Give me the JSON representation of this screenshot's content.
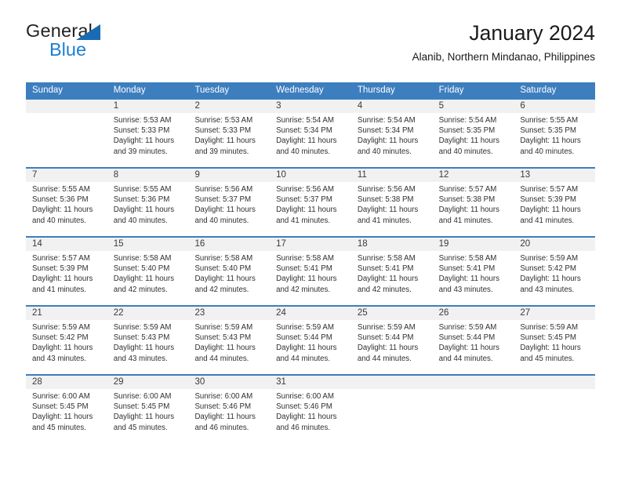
{
  "brand": {
    "name_top": "General",
    "name_bottom": "Blue",
    "colors": {
      "blue": "#1b7fd4",
      "triangle": "#1b6bb3",
      "header_blue": "#3d7ebf",
      "daynum_band": "#f1f1f1"
    }
  },
  "header": {
    "title": "January 2024",
    "subtitle": "Alanib, Northern Mindanao, Philippines"
  },
  "calendar": {
    "weekdays": [
      "Sunday",
      "Monday",
      "Tuesday",
      "Wednesday",
      "Thursday",
      "Friday",
      "Saturday"
    ],
    "weeks": [
      [
        {
          "day": "",
          "sunrise": "",
          "sunset": "",
          "daylight": "",
          "empty": true
        },
        {
          "day": "1",
          "sunrise": "Sunrise: 5:53 AM",
          "sunset": "Sunset: 5:33 PM",
          "daylight": "Daylight: 11 hours and 39 minutes."
        },
        {
          "day": "2",
          "sunrise": "Sunrise: 5:53 AM",
          "sunset": "Sunset: 5:33 PM",
          "daylight": "Daylight: 11 hours and 39 minutes."
        },
        {
          "day": "3",
          "sunrise": "Sunrise: 5:54 AM",
          "sunset": "Sunset: 5:34 PM",
          "daylight": "Daylight: 11 hours and 40 minutes."
        },
        {
          "day": "4",
          "sunrise": "Sunrise: 5:54 AM",
          "sunset": "Sunset: 5:34 PM",
          "daylight": "Daylight: 11 hours and 40 minutes."
        },
        {
          "day": "5",
          "sunrise": "Sunrise: 5:54 AM",
          "sunset": "Sunset: 5:35 PM",
          "daylight": "Daylight: 11 hours and 40 minutes."
        },
        {
          "day": "6",
          "sunrise": "Sunrise: 5:55 AM",
          "sunset": "Sunset: 5:35 PM",
          "daylight": "Daylight: 11 hours and 40 minutes."
        }
      ],
      [
        {
          "day": "7",
          "sunrise": "Sunrise: 5:55 AM",
          "sunset": "Sunset: 5:36 PM",
          "daylight": "Daylight: 11 hours and 40 minutes."
        },
        {
          "day": "8",
          "sunrise": "Sunrise: 5:55 AM",
          "sunset": "Sunset: 5:36 PM",
          "daylight": "Daylight: 11 hours and 40 minutes."
        },
        {
          "day": "9",
          "sunrise": "Sunrise: 5:56 AM",
          "sunset": "Sunset: 5:37 PM",
          "daylight": "Daylight: 11 hours and 40 minutes."
        },
        {
          "day": "10",
          "sunrise": "Sunrise: 5:56 AM",
          "sunset": "Sunset: 5:37 PM",
          "daylight": "Daylight: 11 hours and 41 minutes."
        },
        {
          "day": "11",
          "sunrise": "Sunrise: 5:56 AM",
          "sunset": "Sunset: 5:38 PM",
          "daylight": "Daylight: 11 hours and 41 minutes."
        },
        {
          "day": "12",
          "sunrise": "Sunrise: 5:57 AM",
          "sunset": "Sunset: 5:38 PM",
          "daylight": "Daylight: 11 hours and 41 minutes."
        },
        {
          "day": "13",
          "sunrise": "Sunrise: 5:57 AM",
          "sunset": "Sunset: 5:39 PM",
          "daylight": "Daylight: 11 hours and 41 minutes."
        }
      ],
      [
        {
          "day": "14",
          "sunrise": "Sunrise: 5:57 AM",
          "sunset": "Sunset: 5:39 PM",
          "daylight": "Daylight: 11 hours and 41 minutes."
        },
        {
          "day": "15",
          "sunrise": "Sunrise: 5:58 AM",
          "sunset": "Sunset: 5:40 PM",
          "daylight": "Daylight: 11 hours and 42 minutes."
        },
        {
          "day": "16",
          "sunrise": "Sunrise: 5:58 AM",
          "sunset": "Sunset: 5:40 PM",
          "daylight": "Daylight: 11 hours and 42 minutes."
        },
        {
          "day": "17",
          "sunrise": "Sunrise: 5:58 AM",
          "sunset": "Sunset: 5:41 PM",
          "daylight": "Daylight: 11 hours and 42 minutes."
        },
        {
          "day": "18",
          "sunrise": "Sunrise: 5:58 AM",
          "sunset": "Sunset: 5:41 PM",
          "daylight": "Daylight: 11 hours and 42 minutes."
        },
        {
          "day": "19",
          "sunrise": "Sunrise: 5:58 AM",
          "sunset": "Sunset: 5:41 PM",
          "daylight": "Daylight: 11 hours and 43 minutes."
        },
        {
          "day": "20",
          "sunrise": "Sunrise: 5:59 AM",
          "sunset": "Sunset: 5:42 PM",
          "daylight": "Daylight: 11 hours and 43 minutes."
        }
      ],
      [
        {
          "day": "21",
          "sunrise": "Sunrise: 5:59 AM",
          "sunset": "Sunset: 5:42 PM",
          "daylight": "Daylight: 11 hours and 43 minutes."
        },
        {
          "day": "22",
          "sunrise": "Sunrise: 5:59 AM",
          "sunset": "Sunset: 5:43 PM",
          "daylight": "Daylight: 11 hours and 43 minutes."
        },
        {
          "day": "23",
          "sunrise": "Sunrise: 5:59 AM",
          "sunset": "Sunset: 5:43 PM",
          "daylight": "Daylight: 11 hours and 44 minutes."
        },
        {
          "day": "24",
          "sunrise": "Sunrise: 5:59 AM",
          "sunset": "Sunset: 5:44 PM",
          "daylight": "Daylight: 11 hours and 44 minutes."
        },
        {
          "day": "25",
          "sunrise": "Sunrise: 5:59 AM",
          "sunset": "Sunset: 5:44 PM",
          "daylight": "Daylight: 11 hours and 44 minutes."
        },
        {
          "day": "26",
          "sunrise": "Sunrise: 5:59 AM",
          "sunset": "Sunset: 5:44 PM",
          "daylight": "Daylight: 11 hours and 44 minutes."
        },
        {
          "day": "27",
          "sunrise": "Sunrise: 5:59 AM",
          "sunset": "Sunset: 5:45 PM",
          "daylight": "Daylight: 11 hours and 45 minutes."
        }
      ],
      [
        {
          "day": "28",
          "sunrise": "Sunrise: 6:00 AM",
          "sunset": "Sunset: 5:45 PM",
          "daylight": "Daylight: 11 hours and 45 minutes."
        },
        {
          "day": "29",
          "sunrise": "Sunrise: 6:00 AM",
          "sunset": "Sunset: 5:45 PM",
          "daylight": "Daylight: 11 hours and 45 minutes."
        },
        {
          "day": "30",
          "sunrise": "Sunrise: 6:00 AM",
          "sunset": "Sunset: 5:46 PM",
          "daylight": "Daylight: 11 hours and 46 minutes."
        },
        {
          "day": "31",
          "sunrise": "Sunrise: 6:00 AM",
          "sunset": "Sunset: 5:46 PM",
          "daylight": "Daylight: 11 hours and 46 minutes."
        },
        {
          "day": "",
          "sunrise": "",
          "sunset": "",
          "daylight": "",
          "empty": true
        },
        {
          "day": "",
          "sunrise": "",
          "sunset": "",
          "daylight": "",
          "empty": true
        },
        {
          "day": "",
          "sunrise": "",
          "sunset": "",
          "daylight": "",
          "empty": true
        }
      ]
    ]
  }
}
